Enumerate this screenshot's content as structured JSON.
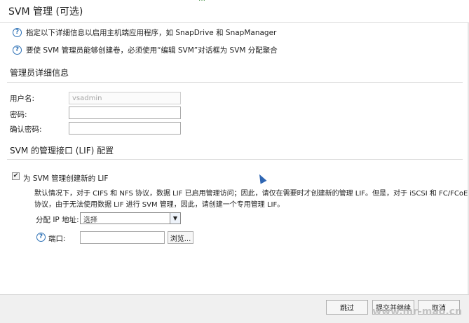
{
  "top_tab_fragment": "…",
  "title": "SVM 管理 (可选)",
  "info": [
    "指定以下详细信息以启用主机端应用程序，如 SnapDrive 和 SnapManager",
    "要使 SVM 管理员能够创建卷，必须使用“编辑 SVM”对话框为 SVM 分配聚合"
  ],
  "admin_section": {
    "heading": "管理员详细信息",
    "username_label": "用户名:",
    "username_value": "vsadmin",
    "password_label": "密码:",
    "confirm_label": "确认密码:"
  },
  "lif_section": {
    "heading": "SVM 的管理接口 (LIF) 配置",
    "checkbox_label": "为 SVM 管理创建新的 LIF",
    "checkbox_checked": true,
    "desc_line1": "默认情况下，对于 CIFS 和 NFS 协议，数据 LIF 已启用管理访问；因此，请仅在需要时才创建新的管理 LIF。但是，对于 iSCSI 和 FC/FCoE",
    "desc_line2": "协议，由于无法使用数据 LIF 进行 SVM 管理，因此，请创建一个专用管理 LIF。",
    "ip_label": "分配 IP 地址:",
    "ip_select_value": "选择",
    "port_label": "端口:",
    "browse_label": "浏览..."
  },
  "footer": {
    "skip_label": "跳过",
    "submit_label": "提交并继续",
    "cancel_label": "取消"
  },
  "watermark": "www.mr-mao.cn"
}
